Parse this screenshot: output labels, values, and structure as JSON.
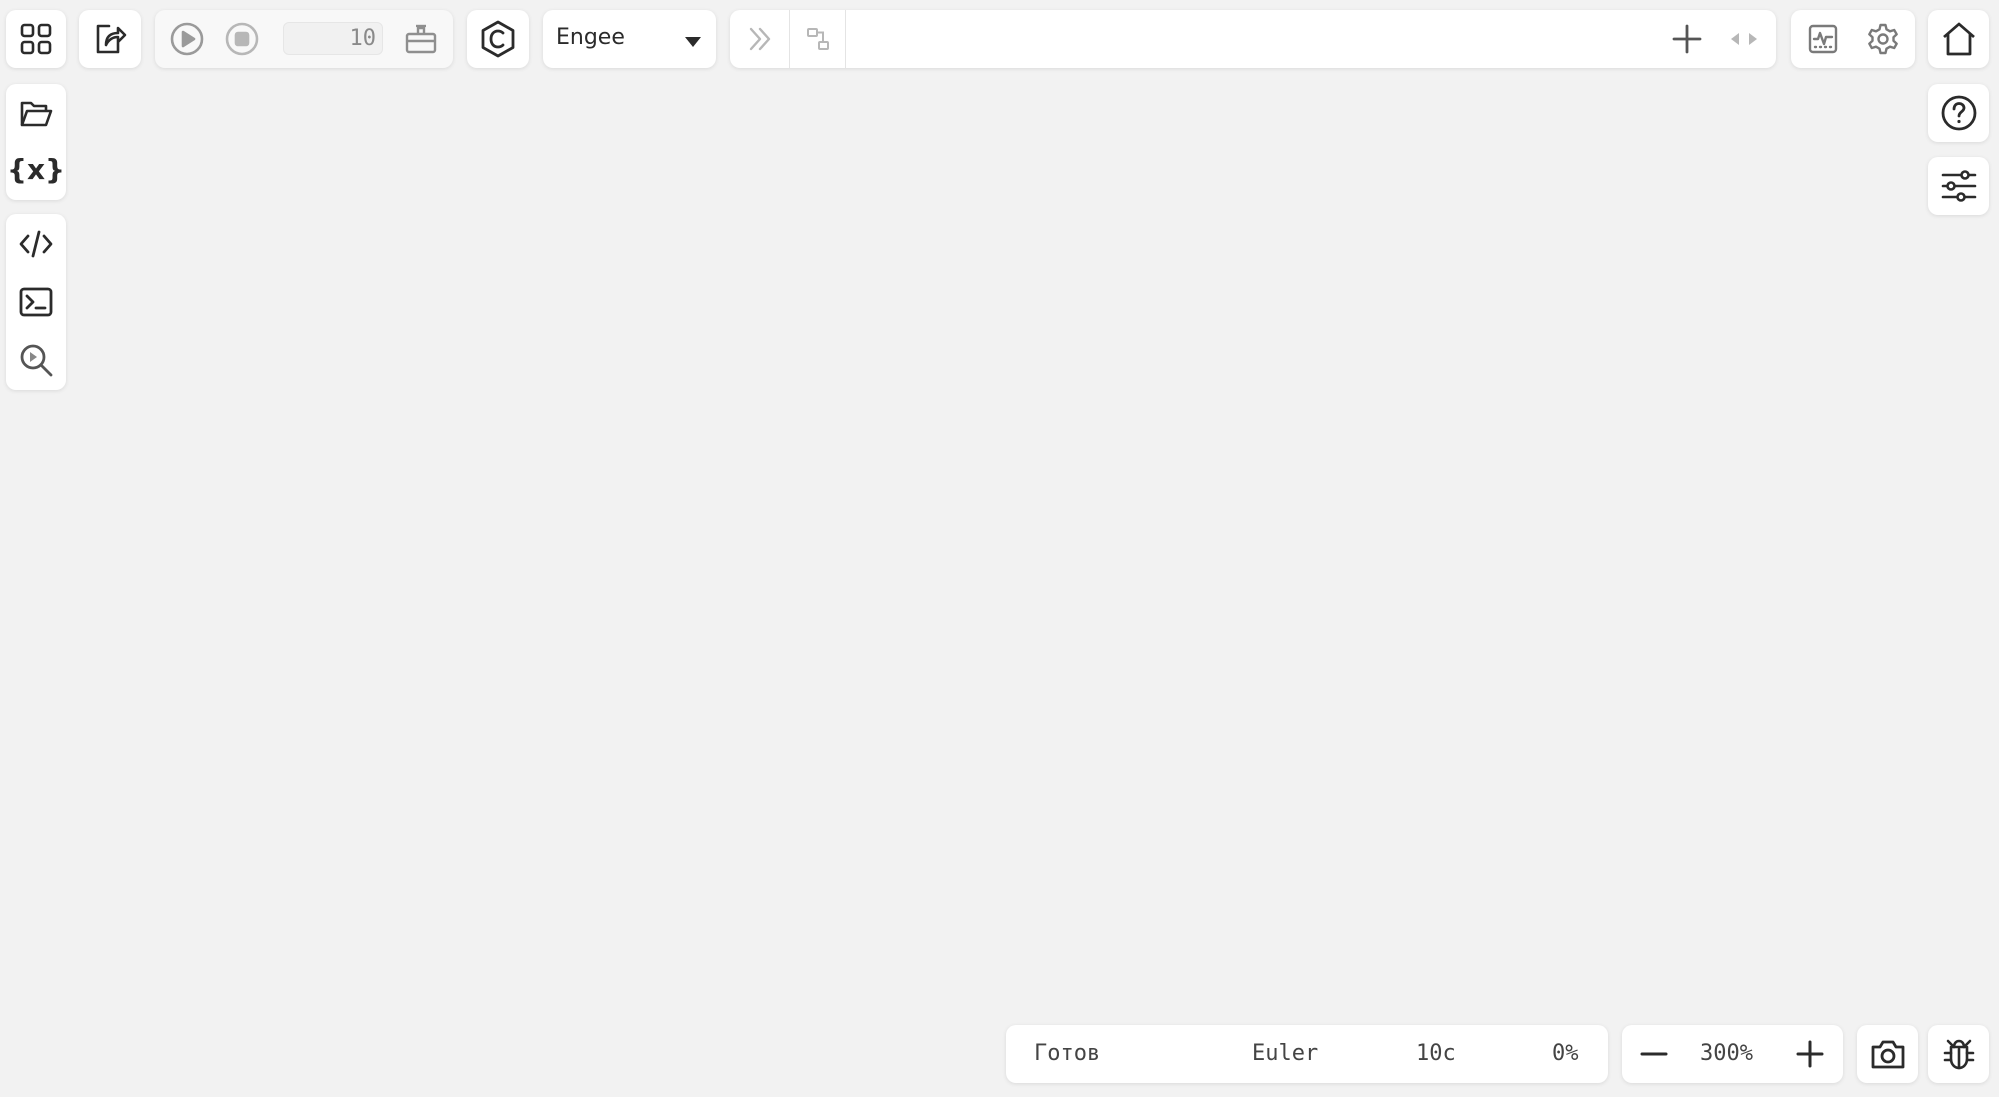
{
  "toolbar": {
    "step_count": "10",
    "solver_type": "Engee"
  },
  "status_bar": {
    "status": "Готов",
    "solver": "Euler",
    "time": "10с",
    "progress": "0%"
  },
  "zoom": {
    "level": "300%"
  },
  "icons": {
    "grid": "grid-icon",
    "export": "export-icon",
    "play": "play-icon",
    "stop": "stop-icon",
    "package": "package-icon",
    "compile": "compile-icon",
    "dropdown": "chevron-down-icon",
    "double_chevron": "double-chevron-right-icon",
    "blocks": "blocks-icon",
    "add": "plus-icon",
    "arrows": "left-right-arrows-icon",
    "chart": "chart-icon",
    "settings": "gear-icon",
    "home": "home-icon",
    "folder": "folder-open-icon",
    "variables": "variables-icon",
    "code": "code-icon",
    "terminal": "terminal-icon",
    "search": "search-play-icon",
    "help": "help-icon",
    "sliders": "sliders-icon",
    "minus": "minus-icon",
    "camera": "camera-icon",
    "bug": "bug-icon"
  },
  "colors": {
    "background": "#f2f2f2",
    "panel": "#ffffff",
    "icon_active": "#2b2b2b",
    "icon_disabled": "#b7b7b7"
  }
}
